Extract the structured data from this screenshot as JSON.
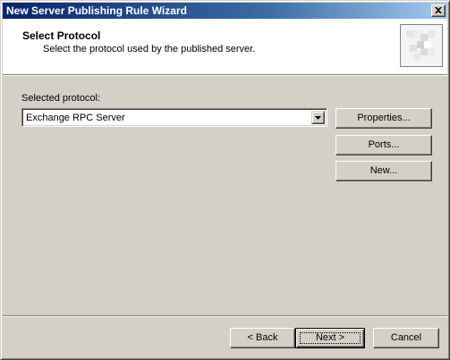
{
  "window": {
    "title": "New Server Publishing Rule Wizard"
  },
  "header": {
    "title": "Select Protocol",
    "subtitle": "Select the protocol used by the published server."
  },
  "protocol": {
    "label": "Selected protocol:",
    "selected_value": "Exchange RPC Server"
  },
  "side_buttons": {
    "properties": "Properties...",
    "ports": "Ports...",
    "new": "New..."
  },
  "footer_buttons": {
    "back": "< Back",
    "next": "Next >",
    "cancel": "Cancel"
  },
  "icons": {
    "close": "close-icon",
    "dropdown": "chevron-down-icon",
    "wizard": "wizard-banner-icon"
  },
  "colors": {
    "title_bar_start": "#0a246a",
    "title_bar_end": "#a6caf0",
    "dialog_face": "#d4d0c8",
    "header_background": "#ffffff"
  }
}
